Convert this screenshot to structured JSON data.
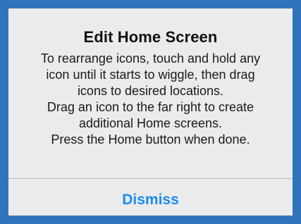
{
  "alert": {
    "title": "Edit Home Screen",
    "message_lines": [
      "To rearrange icons, touch and hold any",
      "icon until it starts to wiggle, then drag",
      "icons to desired locations.",
      "Drag an icon to the far right to create",
      "additional Home screens.",
      "Press the Home button when done."
    ],
    "dismiss_label": "Dismiss"
  },
  "colors": {
    "background_blue": "#2f74bb",
    "alert_background": "#ebebeb",
    "button_blue": "#1a8cf0"
  }
}
